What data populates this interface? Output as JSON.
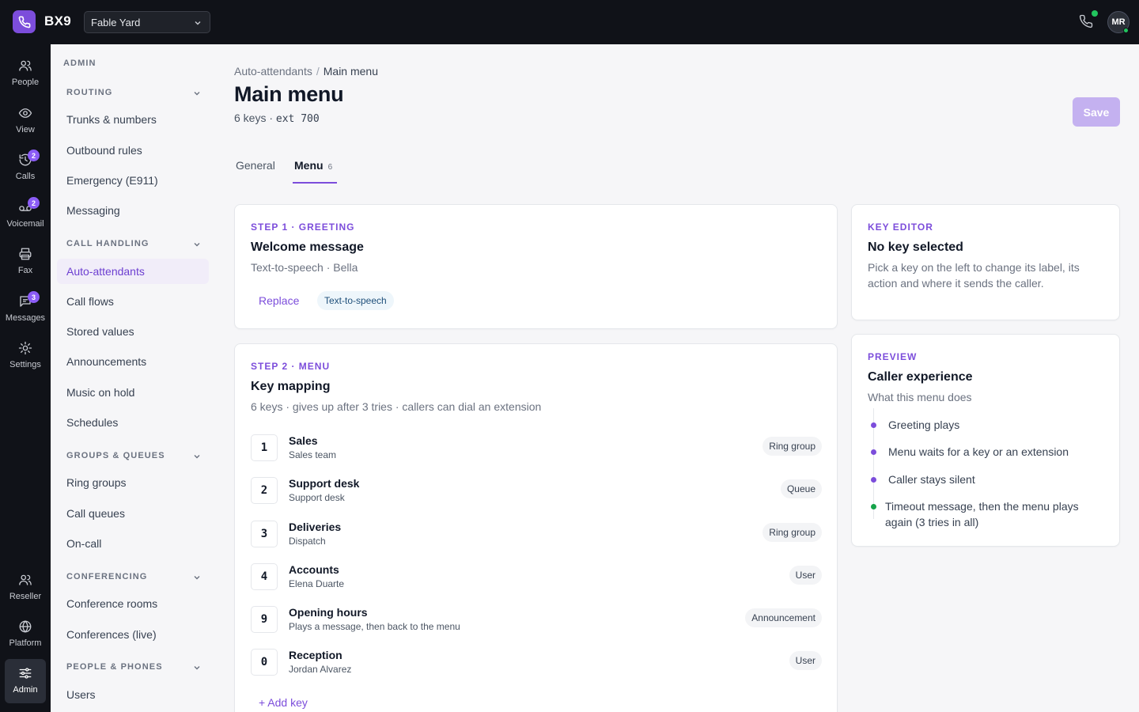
{
  "app": {
    "brand": "BX9",
    "org": "Fable Yard",
    "user_initials": "MR"
  },
  "colors": {
    "accent": "#7c4ddb",
    "topbar": "#101218",
    "online": "#22c55e"
  },
  "rail": [
    {
      "label": "People",
      "icon": "people-icon"
    },
    {
      "label": "View",
      "icon": "eye-icon"
    },
    {
      "label": "Calls",
      "icon": "call-history-icon",
      "badge": "2"
    },
    {
      "label": "Voicemail",
      "icon": "voicemail-icon",
      "badge": "2"
    },
    {
      "label": "Fax",
      "icon": "printer-icon"
    },
    {
      "label": "Messages",
      "icon": "chat-icon",
      "badge": "3"
    },
    {
      "label": "Settings",
      "icon": "sun-icon"
    },
    {
      "label": "Reseller",
      "icon": "people-icon"
    },
    {
      "label": "Platform",
      "icon": "globe-icon"
    },
    {
      "label": "Admin",
      "icon": "sliders-icon"
    }
  ],
  "sidebar": {
    "heading": "ADMIN",
    "sections": [
      {
        "title": "ROUTING",
        "items": [
          "Trunks & numbers",
          "Outbound rules",
          "Emergency (E911)",
          "Messaging"
        ]
      },
      {
        "title": "CALL HANDLING",
        "items": [
          "Auto-attendants",
          "Call flows",
          "Stored values",
          "Announcements",
          "Music on hold",
          "Schedules"
        ]
      },
      {
        "title": "GROUPS & QUEUES",
        "items": [
          "Ring groups",
          "Call queues",
          "On-call"
        ]
      },
      {
        "title": "CONFERENCING",
        "items": [
          "Conference rooms",
          "Conferences (live)"
        ]
      },
      {
        "title": "PEOPLE & PHONES",
        "items": [
          "Users"
        ]
      }
    ],
    "active_item": "Auto-attendants"
  },
  "page": {
    "breadcrumb": [
      "Auto-attendants",
      "Main menu"
    ],
    "title": "Main menu",
    "subtitle_prefix": "6 keys · ",
    "subtitle_ext": "ext 700",
    "save_label": "Save"
  },
  "tabs": [
    {
      "label": "General"
    },
    {
      "label": "Menu",
      "count": "6",
      "active": true
    }
  ],
  "greeting": {
    "step": "STEP 1 · GREETING",
    "title": "Welcome message",
    "sub": "Text-to-speech · Bella",
    "replace_label": "Replace",
    "chip": "Text-to-speech"
  },
  "menu": {
    "step": "STEP 2 · MENU",
    "title": "Key mapping",
    "sub": "6 keys · gives up after 3 tries · callers can dial an extension",
    "keys": [
      {
        "key": "1",
        "name": "Sales",
        "desc": "Sales team",
        "type": "Ring group"
      },
      {
        "key": "2",
        "name": "Support desk",
        "desc": "Support desk",
        "type": "Queue"
      },
      {
        "key": "3",
        "name": "Deliveries",
        "desc": "Dispatch",
        "type": "Ring group"
      },
      {
        "key": "4",
        "name": "Accounts",
        "desc": "Elena Duarte",
        "type": "User"
      },
      {
        "key": "9",
        "name": "Opening hours",
        "desc": "Plays a message, then back to the menu",
        "type": "Announcement"
      },
      {
        "key": "0",
        "name": "Reception",
        "desc": "Jordan Alvarez",
        "type": "User"
      }
    ],
    "add_label": "+ Add key"
  },
  "key_editor": {
    "label": "KEY EDITOR",
    "title": "No key selected",
    "body": "Pick a key on the left to change its label, its action and where it sends the caller."
  },
  "preview": {
    "label": "PREVIEW",
    "title": "Caller experience",
    "sub": "What this menu does",
    "steps": [
      {
        "text": "Greeting plays"
      },
      {
        "text": "Menu waits for a key or an extension"
      },
      {
        "text": "Caller stays silent"
      },
      {
        "text": "Timeout message, then the menu plays again (3 tries in all)",
        "final": true
      }
    ]
  }
}
